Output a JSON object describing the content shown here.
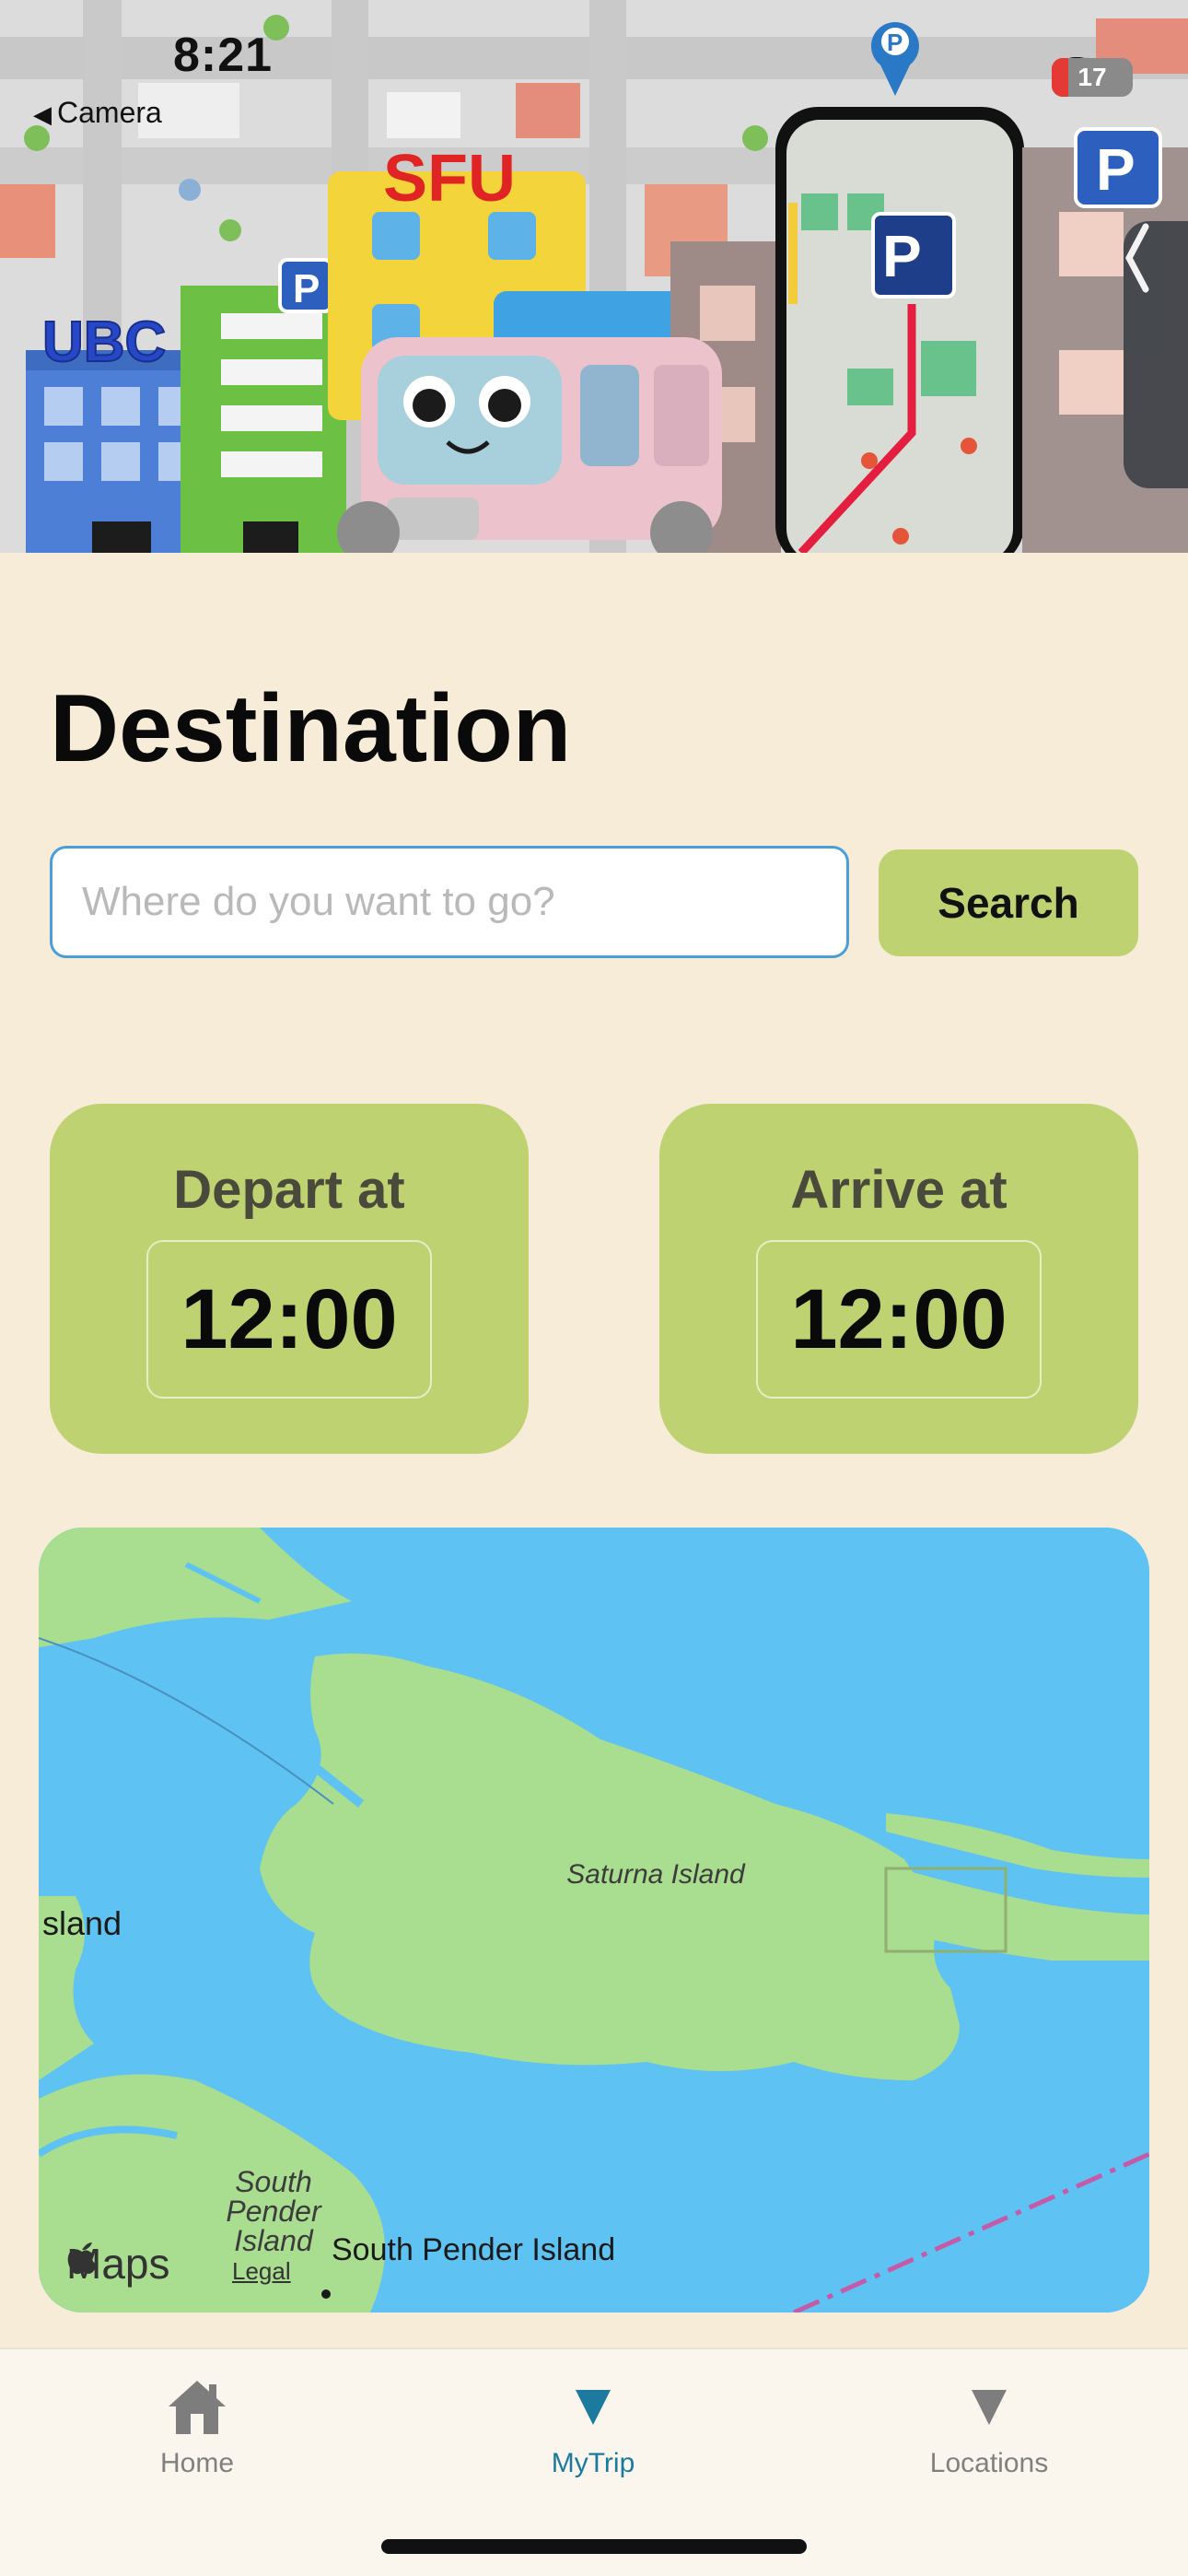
{
  "status_bar": {
    "time": "8:21",
    "back_label": "Camera",
    "battery": "17"
  },
  "hero": {
    "sign_left": "UBC",
    "sign_center": "SFU",
    "parking_letter": "P"
  },
  "destination": {
    "title": "Destination",
    "search_placeholder": "Where do you want to go?",
    "search_button": "Search"
  },
  "times": {
    "depart_label": "Depart at",
    "depart_time": "12:00",
    "arrive_label": "Arrive at",
    "arrive_time": "12:00"
  },
  "map": {
    "saturna_label": "Saturna Island",
    "left_island_label": "sland",
    "south_pender_italic": "South Pender Island",
    "south_pender_label": "South Pender Island",
    "maps_brand": "Maps",
    "legal_link": "Legal"
  },
  "tabs": [
    {
      "label": "Home",
      "icon": "house-icon",
      "active": false
    },
    {
      "label": "MyTrip",
      "icon": "triangle-down-icon",
      "active": true
    },
    {
      "label": "Locations",
      "icon": "triangle-down-icon",
      "active": false
    }
  ],
  "colors": {
    "background": "#f7ecd8",
    "card_green": "#bfd271",
    "active_tab": "#1b7a9e",
    "input_border": "#4a9fd8"
  }
}
